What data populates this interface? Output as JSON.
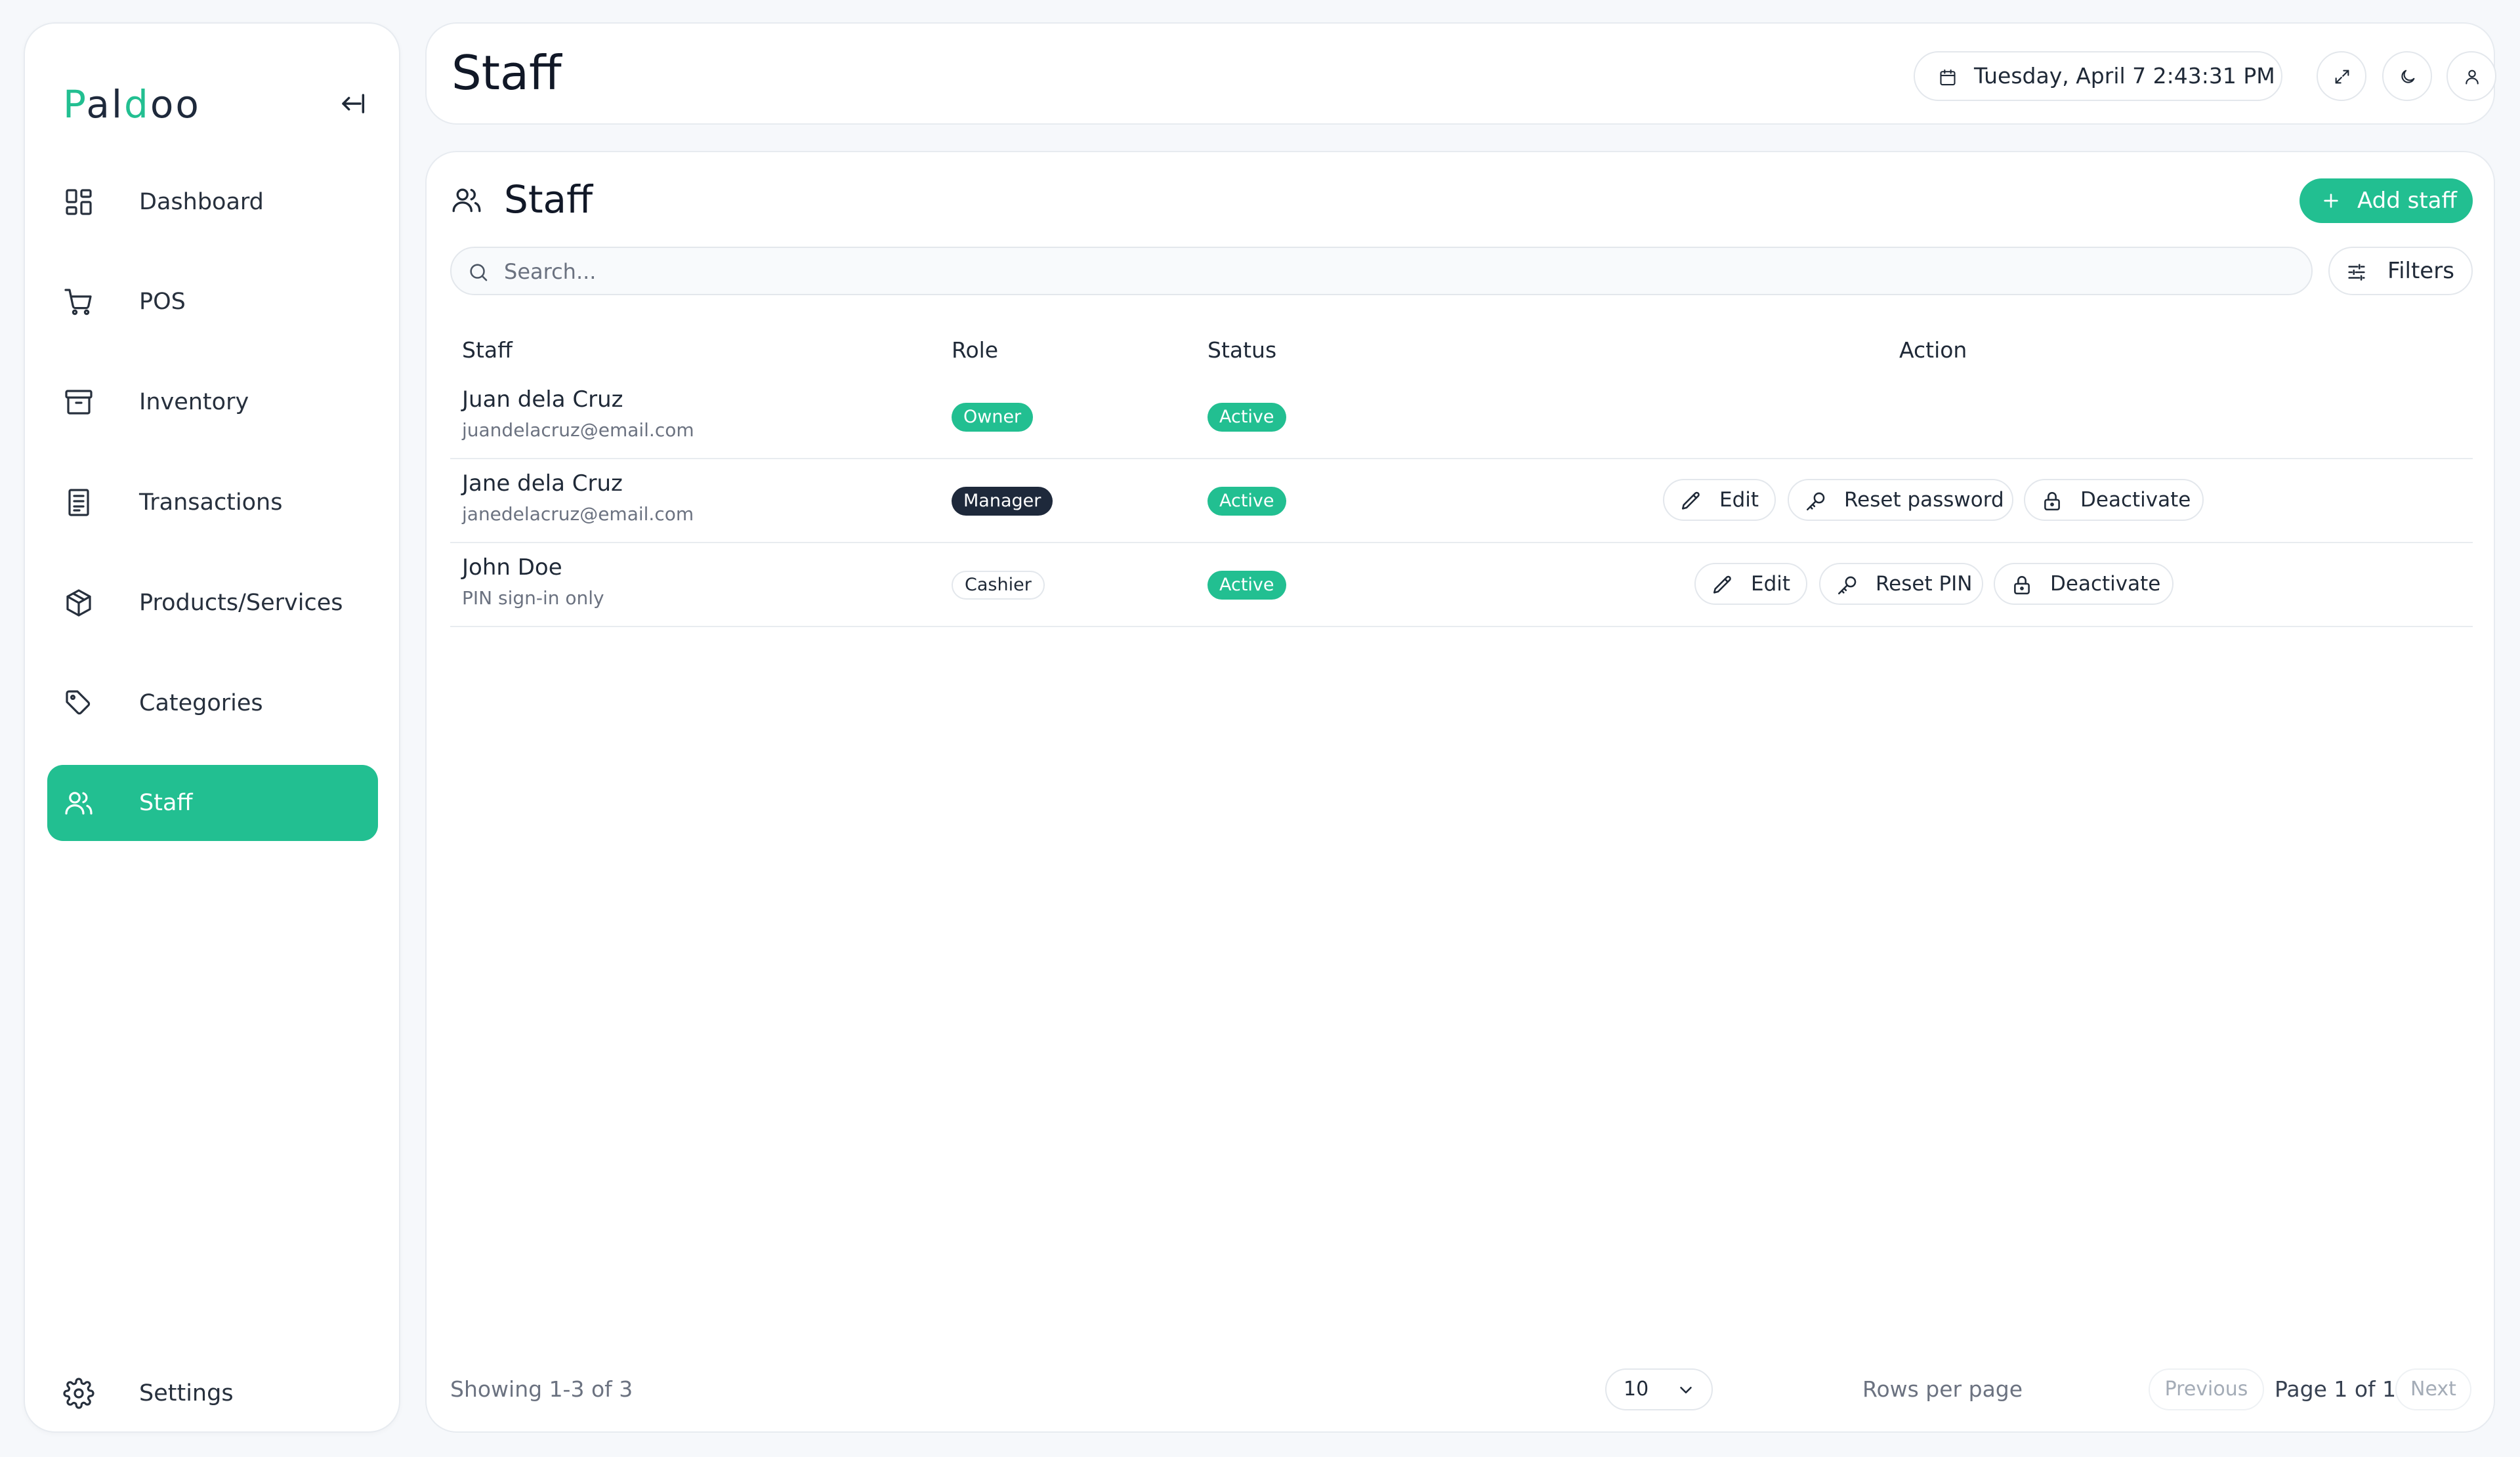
{
  "app": {
    "logo_letter": "P",
    "logo_part1": "al",
    "logo_accent": "d",
    "logo_part2": "oo",
    "brand_color": "#22bf91"
  },
  "sidebar": {
    "items": [
      {
        "label": "Dashboard",
        "icon": "dashboard-icon"
      },
      {
        "label": "POS",
        "icon": "cart-icon"
      },
      {
        "label": "Inventory",
        "icon": "archive-icon"
      },
      {
        "label": "Transactions",
        "icon": "receipt-icon"
      },
      {
        "label": "Products/Services",
        "icon": "package-icon"
      },
      {
        "label": "Categories",
        "icon": "tags-icon"
      },
      {
        "label": "Staff",
        "icon": "users-icon",
        "active": true
      }
    ],
    "settings_label": "Settings"
  },
  "header": {
    "title": "Staff",
    "datetime": "Tuesday, April 7 2:43:31 PM"
  },
  "main": {
    "title": "Staff",
    "add_button_label": "Add staff",
    "search_placeholder": "Search...",
    "filters_label": "Filters",
    "columns": [
      "Staff",
      "Role",
      "Status",
      "Action"
    ],
    "rows": [
      {
        "name": "Juan dela Cruz",
        "sub": "juandelacruz@email.com",
        "role": "Owner",
        "status": "Active",
        "actions": []
      },
      {
        "name": "Jane dela Cruz",
        "sub": "janedelacruz@email.com",
        "role": "Manager",
        "status": "Active",
        "actions": [
          "Edit",
          "Reset password",
          "Deactivate"
        ]
      },
      {
        "name": "John Doe",
        "sub": "PIN sign-in only",
        "role": "Cashier",
        "status": "Active",
        "actions": [
          "Edit",
          "Reset PIN",
          "Deactivate"
        ]
      }
    ]
  },
  "footer": {
    "showing": "Showing 1-3 of 3",
    "rows_per_page_label": "Rows per page",
    "rows_per_page_value": "10",
    "previous_label": "Previous",
    "page_info": "Page 1 of 1",
    "next_label": "Next"
  }
}
